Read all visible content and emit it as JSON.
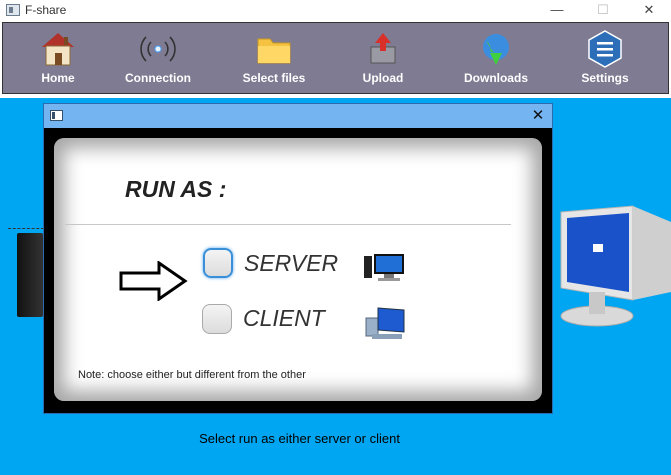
{
  "window": {
    "title": "F-share",
    "minimize": "—",
    "maximize": "☐",
    "close": "✕"
  },
  "toolbar": {
    "items": [
      {
        "label": "Home",
        "icon": "home-icon"
      },
      {
        "label": "Connection",
        "icon": "connection-icon"
      },
      {
        "label": "Select files",
        "icon": "folder-icon"
      },
      {
        "label": "Upload",
        "icon": "upload-icon"
      },
      {
        "label": "Downloads",
        "icon": "downloads-globe-icon"
      },
      {
        "label": "Settings",
        "icon": "settings-icon"
      }
    ]
  },
  "dialog": {
    "close": "✕",
    "heading": "RUN AS :",
    "options": [
      {
        "label": "SERVER",
        "focused": true,
        "icon": "server-computer-icon"
      },
      {
        "label": "CLIENT",
        "focused": false,
        "icon": "client-computer-icon"
      }
    ],
    "note": "Note: choose either but different from the other"
  },
  "main": {
    "message": "Select run as either server or client"
  },
  "colors": {
    "toolbar": "#7f7b92",
    "background": "#00a6f2",
    "dialog_title": "#74b4f0"
  }
}
